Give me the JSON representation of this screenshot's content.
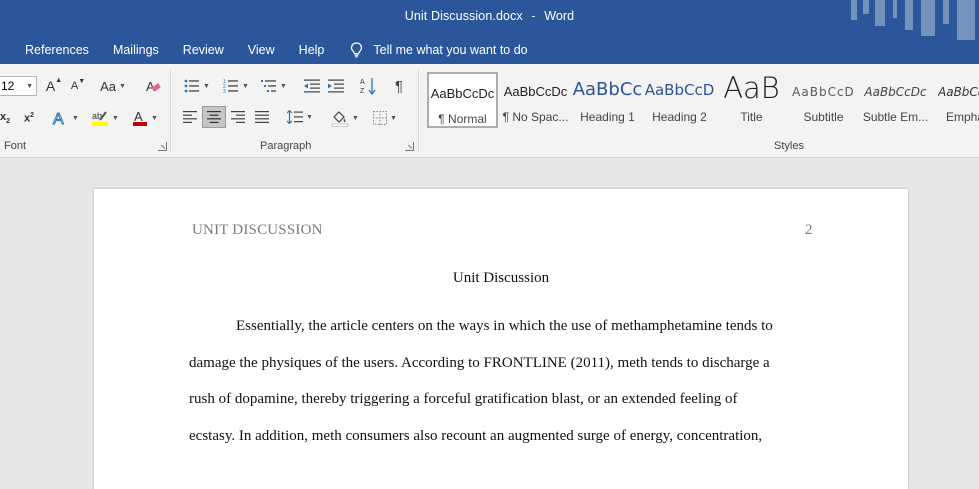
{
  "window": {
    "doc_name": "Unit Discussion.docx",
    "separator": "-",
    "app_name": "Word"
  },
  "tabs": [
    "References",
    "Mailings",
    "Review",
    "View",
    "Help"
  ],
  "tell_me": "Tell me what you want to do",
  "ribbon": {
    "font_size": "12",
    "font_group_label": "Font",
    "paragraph_group_label": "Paragraph",
    "styles_group_label": "Styles",
    "grow_font_glyph": "A",
    "change_case_glyph": "Aa",
    "pilcrow": "¶"
  },
  "styles": [
    {
      "preview": "AaBbCcDc",
      "name": "¶ Normal"
    },
    {
      "preview": "AaBbCcDc",
      "name": "¶ No Spac..."
    },
    {
      "preview": "AaBbCc",
      "name": "Heading 1"
    },
    {
      "preview": "AaBbCcD",
      "name": "Heading 2"
    },
    {
      "preview": "AaB",
      "name": "Title"
    },
    {
      "preview": "AaBbCcD",
      "name": "Subtitle"
    },
    {
      "preview": "AaBbCcDc",
      "name": "Subtle Em..."
    },
    {
      "preview": "AaBbCcDc",
      "name": "Empha"
    }
  ],
  "colors": {
    "word_blue": "#2b579a",
    "highlight_yellow": "#ffff00",
    "font_color_red": "#c00000",
    "heading_blue": "#2f5496"
  },
  "document": {
    "header_text": "UNIT DISCUSSION",
    "page_number": "2",
    "title": "Unit Discussion",
    "lines": [
      "Essentially, the article centers on the ways in which the use of methamphetamine tends to",
      "damage the physiques of the users. According to FRONTLINE (2011), meth tends to discharge a",
      "rush of dopamine, thereby triggering a forceful gratification blast, or an extended feeling of",
      "ecstasy. In addition, meth consumers also recount an augmented surge of energy, concentration,"
    ]
  }
}
